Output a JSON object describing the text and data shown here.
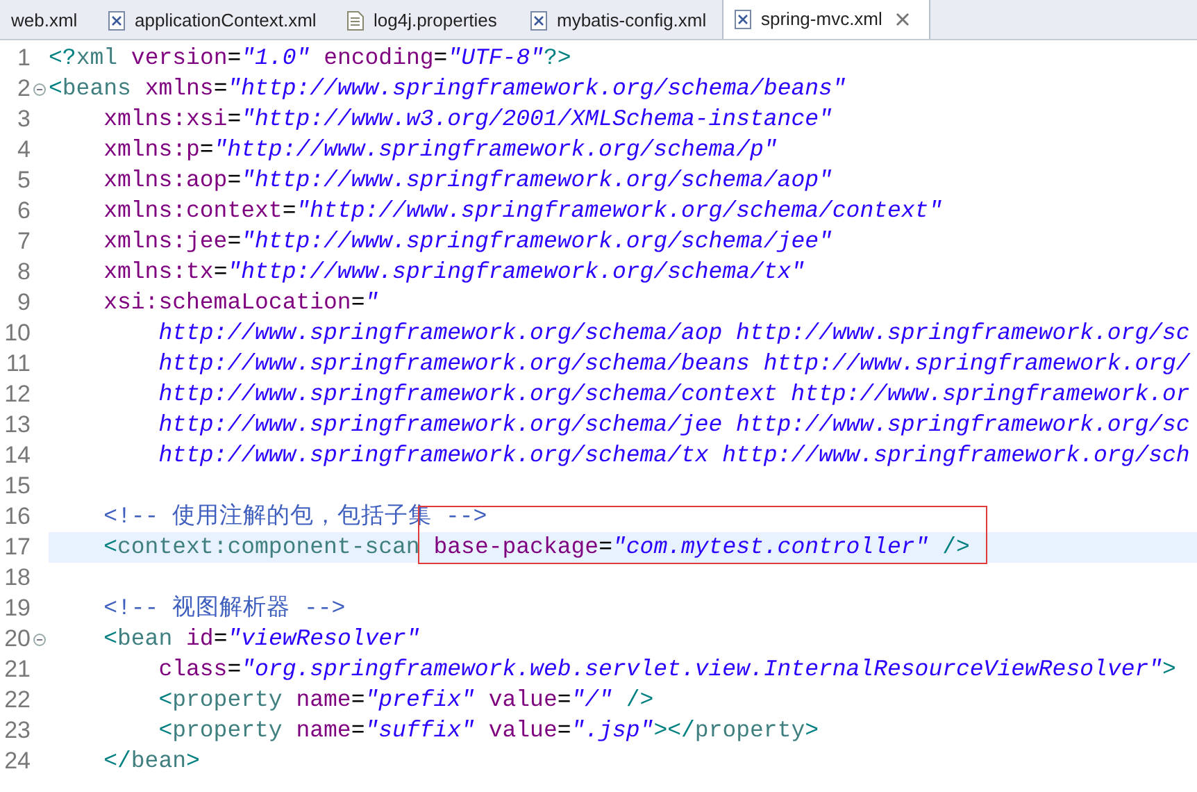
{
  "tabs": [
    {
      "label": "web.xml",
      "kind": "plain",
      "selected": false
    },
    {
      "label": "applicationContext.xml",
      "kind": "xml",
      "selected": false
    },
    {
      "label": "log4j.properties",
      "kind": "text",
      "selected": false
    },
    {
      "label": "mybatis-config.xml",
      "kind": "xml",
      "selected": false
    },
    {
      "label": "spring-mvc.xml",
      "kind": "xml",
      "selected": true
    }
  ],
  "lines": [
    {
      "number": "1",
      "tokens": [
        {
          "kind": "punct",
          "text": "<?"
        },
        {
          "kind": "tag",
          "text": "xml"
        },
        {
          "kind": "attr",
          "text": " version"
        },
        {
          "kind": "text",
          "text": "="
        },
        {
          "kind": "value",
          "text": "\"1.0\""
        },
        {
          "kind": "attr",
          "text": " encoding"
        },
        {
          "kind": "text",
          "text": "="
        },
        {
          "kind": "value",
          "text": "\"UTF-8\""
        },
        {
          "kind": "punct",
          "text": "?>"
        }
      ]
    },
    {
      "number": "2",
      "folding": true,
      "tokens": [
        {
          "kind": "punct",
          "text": "<"
        },
        {
          "kind": "tag",
          "text": "beans"
        },
        {
          "kind": "attr",
          "text": " xmlns"
        },
        {
          "kind": "text",
          "text": "="
        },
        {
          "kind": "value",
          "text": "\"http://www.springframework.org/schema/beans\""
        }
      ],
      "children": [
        {
          "number": "3",
          "tokens": [
            {
              "kind": "attr",
              "text": "xmlns:xsi"
            },
            {
              "kind": "text",
              "text": "="
            },
            {
              "kind": "value",
              "text": "\"http://www.w3.org/2001/XMLSchema-instance\""
            }
          ]
        },
        {
          "number": "4",
          "tokens": [
            {
              "kind": "attr",
              "text": "xmlns:p"
            },
            {
              "kind": "text",
              "text": "="
            },
            {
              "kind": "value",
              "text": "\"http://www.springframework.org/schema/p\""
            }
          ]
        },
        {
          "number": "5",
          "tokens": [
            {
              "kind": "attr",
              "text": "xmlns:aop"
            },
            {
              "kind": "text",
              "text": "="
            },
            {
              "kind": "value",
              "text": "\"http://www.springframework.org/schema/aop\""
            }
          ]
        },
        {
          "number": "6",
          "tokens": [
            {
              "kind": "attr",
              "text": "xmlns:context"
            },
            {
              "kind": "text",
              "text": "="
            },
            {
              "kind": "value",
              "text": "\"http://www.springframework.org/schema/context\""
            }
          ]
        },
        {
          "number": "7",
          "tokens": [
            {
              "kind": "attr",
              "text": "xmlns:jee"
            },
            {
              "kind": "text",
              "text": "="
            },
            {
              "kind": "value",
              "text": "\"http://www.springframework.org/schema/jee\""
            }
          ]
        },
        {
          "number": "8",
          "tokens": [
            {
              "kind": "attr",
              "text": "xmlns:tx"
            },
            {
              "kind": "text",
              "text": "="
            },
            {
              "kind": "value",
              "text": "\"http://www.springframework.org/schema/tx\""
            }
          ]
        },
        {
          "number": "9",
          "tokens": [
            {
              "kind": "attr",
              "text": "xsi:schemaLocation"
            },
            {
              "kind": "text",
              "text": "="
            },
            {
              "kind": "value",
              "text": "\""
            }
          ],
          "children": [
            {
              "number": "10",
              "tokens": [
                {
                  "kind": "value",
                  "text": "http://www.springframework.org/schema/aop http://www.springframework.org/sc"
                }
              ]
            },
            {
              "number": "11",
              "tokens": [
                {
                  "kind": "value",
                  "text": "http://www.springframework.org/schema/beans http://www.springframework.org/"
                }
              ]
            },
            {
              "number": "12",
              "tokens": [
                {
                  "kind": "value",
                  "text": "http://www.springframework.org/schema/context http://www.springframework.or"
                }
              ]
            },
            {
              "number": "13",
              "tokens": [
                {
                  "kind": "value",
                  "text": "http://www.springframework.org/schema/jee http://www.springframework.org/sc"
                }
              ]
            },
            {
              "number": "14",
              "tokens": [
                {
                  "kind": "value",
                  "text": "http://www.springframework.org/schema/tx http://www.springframework.org/sch"
                }
              ]
            }
          ]
        },
        {
          "number": "15"
        },
        {
          "number": "16",
          "tokens": [
            {
              "kind": "comment",
              "text": "<!-- 使用注解的包，包括子集 -->"
            }
          ]
        },
        {
          "number": "17",
          "current": true,
          "tokens": [
            {
              "kind": "punct",
              "text": "<"
            },
            {
              "kind": "tag",
              "text": "context:component-scan"
            },
            {
              "kind": "attr",
              "text": " base-package",
              "boxed": true
            },
            {
              "kind": "text",
              "text": "=",
              "boxed": true
            },
            {
              "kind": "value",
              "text": "\"com.mytest.controller\"",
              "boxed": true
            },
            {
              "kind": "punct",
              "text": " />",
              "boxed": true
            }
          ]
        },
        {
          "number": "18"
        },
        {
          "number": "19",
          "tokens": [
            {
              "kind": "comment",
              "text": "<!-- 视图解析器 -->"
            }
          ]
        },
        {
          "number": "20",
          "folding": true,
          "tokens": [
            {
              "kind": "punct",
              "text": "<"
            },
            {
              "kind": "tag",
              "text": "bean"
            },
            {
              "kind": "attr",
              "text": " id"
            },
            {
              "kind": "text",
              "text": "="
            },
            {
              "kind": "value",
              "text": "\"viewResolver\""
            }
          ],
          "children": [
            {
              "number": "21",
              "tokens": [
                {
                  "kind": "attr",
                  "text": "class"
                },
                {
                  "kind": "text",
                  "text": "="
                },
                {
                  "kind": "value",
                  "text": "\"org.springframework.web.servlet.view.InternalResourceViewResolver\""
                },
                {
                  "kind": "punct",
                  "text": ">"
                }
              ]
            },
            {
              "number": "22",
              "tokens": [
                {
                  "kind": "punct",
                  "text": "<"
                },
                {
                  "kind": "tag",
                  "text": "property"
                },
                {
                  "kind": "attr",
                  "text": " name"
                },
                {
                  "kind": "text",
                  "text": "="
                },
                {
                  "kind": "value",
                  "text": "\"prefix\""
                },
                {
                  "kind": "attr",
                  "text": " value"
                },
                {
                  "kind": "text",
                  "text": "="
                },
                {
                  "kind": "value",
                  "text": "\"/\""
                },
                {
                  "kind": "punct",
                  "text": " />"
                }
              ]
            },
            {
              "number": "23",
              "tokens": [
                {
                  "kind": "punct",
                  "text": "<"
                },
                {
                  "kind": "tag",
                  "text": "property"
                },
                {
                  "kind": "attr",
                  "text": " name"
                },
                {
                  "kind": "text",
                  "text": "="
                },
                {
                  "kind": "value",
                  "text": "\"suffix\""
                },
                {
                  "kind": "attr",
                  "text": " value"
                },
                {
                  "kind": "text",
                  "text": "="
                },
                {
                  "kind": "value",
                  "text": "\".jsp\""
                },
                {
                  "kind": "punct",
                  "text": "></"
                },
                {
                  "kind": "tag",
                  "text": "property"
                },
                {
                  "kind": "punct",
                  "text": ">"
                }
              ]
            }
          ]
        },
        {
          "number": "24",
          "tokens": [
            {
              "kind": "punct",
              "text": "</"
            },
            {
              "kind": "tag",
              "text": "bean"
            },
            {
              "kind": "punct",
              "text": ">"
            }
          ]
        }
      ]
    }
  ]
}
